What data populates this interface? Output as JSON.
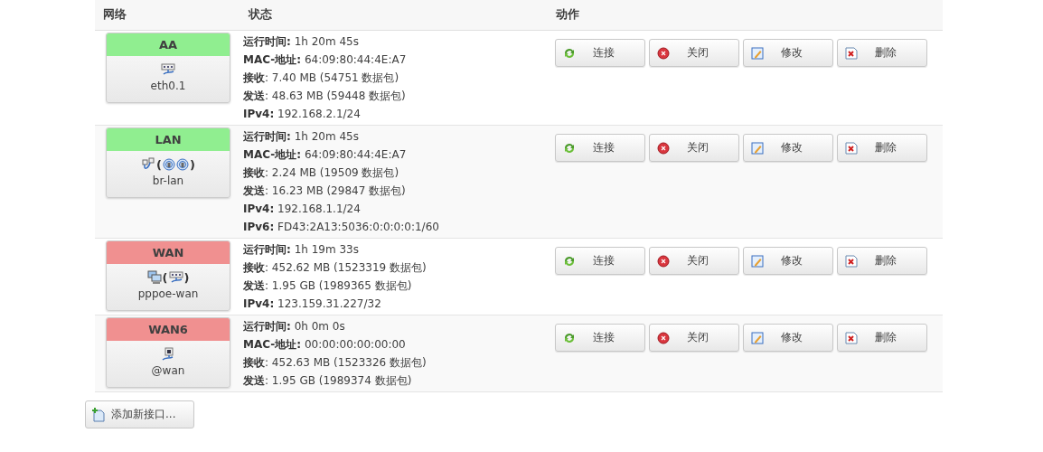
{
  "table": {
    "columns": [
      "网络",
      "状态",
      "动作"
    ],
    "rows": [
      {
        "name": "AA",
        "color": "#90ee90",
        "icons": [
          {
            "kind": "ethernet"
          }
        ],
        "device": "eth0.1",
        "status": [
          "**运行时间:** 1h 20m 45s",
          "**MAC-地址:** 64:09:80:44:4E:A7",
          "**接收**: 7.40 MB (54751 数据包)",
          "**发送**: 48.63 MB (59448 数据包)",
          "**IPv4:** 192.168.2.1/24"
        ],
        "buttons": [
          {
            "kind": "connect",
            "label": "连接"
          },
          {
            "kind": "stop",
            "label": "关闭"
          },
          {
            "kind": "edit",
            "label": "修改"
          },
          {
            "kind": "delete",
            "label": "删除"
          }
        ]
      },
      {
        "name": "LAN",
        "color": "#90ee90",
        "icons": [
          {
            "kind": "bridge"
          },
          {
            "kind": "group",
            "open": "(",
            "close": ")",
            "children": [
              {
                "kind": "wireless"
              },
              {
                "kind": "wireless"
              }
            ]
          }
        ],
        "device": "br-lan",
        "status": [
          "**运行时间:** 1h 20m 45s",
          "**MAC-地址:** 64:09:80:44:4E:A7",
          "**接收**: 2.24 MB (19509 数据包)",
          "**发送**: 16.23 MB (29847 数据包)",
          "**IPv4:** 192.168.1.1/24",
          "**IPv6:** FD43:2A13:5036:0:0:0:0:1/60"
        ],
        "buttons": [
          {
            "kind": "connect",
            "label": "连接"
          },
          {
            "kind": "stop",
            "label": "关闭"
          },
          {
            "kind": "edit",
            "label": "修改"
          },
          {
            "kind": "delete",
            "label": "删除"
          }
        ]
      },
      {
        "name": "WAN",
        "color": "#f09090",
        "icons": [
          {
            "kind": "computer"
          },
          {
            "kind": "group",
            "open": "(",
            "close": ")",
            "children": [
              {
                "kind": "ethernet"
              }
            ]
          }
        ],
        "device": "pppoe-wan",
        "status": [
          "**运行时间:** 1h 19m 33s",
          "**接收**: 452.62 MB (1523319 数据包)",
          "**发送**: 1.95 GB (1989365 数据包)",
          "**IPv4:** 123.159.31.227/32"
        ],
        "buttons": [
          {
            "kind": "connect",
            "label": "连接"
          },
          {
            "kind": "stop",
            "label": "关闭"
          },
          {
            "kind": "edit",
            "label": "修改"
          },
          {
            "kind": "delete",
            "label": "删除"
          }
        ]
      },
      {
        "name": "WAN6",
        "color": "#f09090",
        "icons": [
          {
            "kind": "port"
          }
        ],
        "device": "@wan",
        "status": [
          "**运行时间:** 0h 0m 0s",
          "**MAC-地址:** 00:00:00:00:00:00",
          "**接收**: 452.63 MB (1523326 数据包)",
          "**发送**: 1.95 GB (1989374 数据包)"
        ],
        "buttons": [
          {
            "kind": "connect",
            "label": "连接"
          },
          {
            "kind": "stop",
            "label": "关闭"
          },
          {
            "kind": "edit",
            "label": "修改"
          },
          {
            "kind": "delete",
            "label": "删除"
          }
        ]
      }
    ]
  },
  "add_button": {
    "label": "添加新接口..."
  }
}
